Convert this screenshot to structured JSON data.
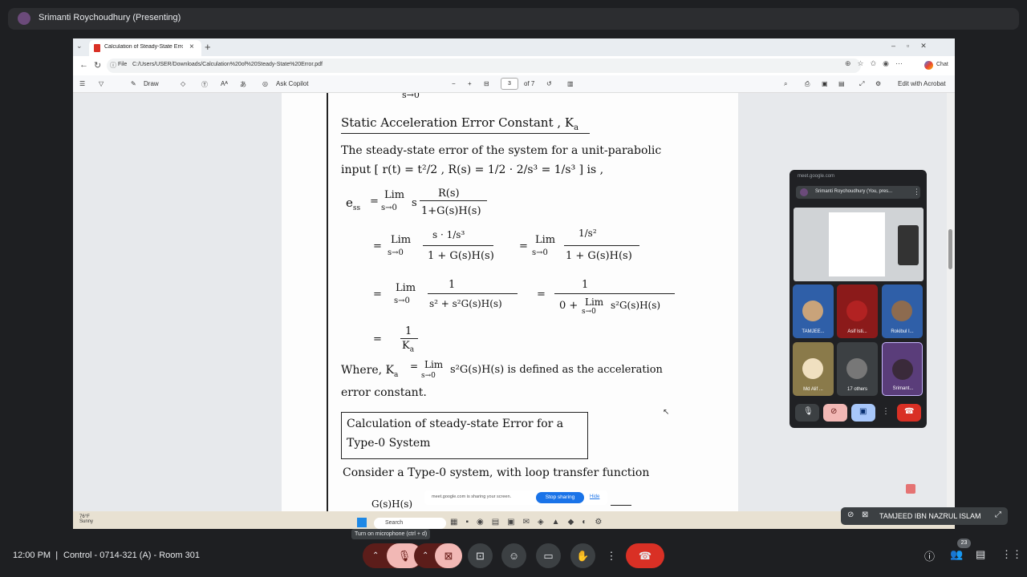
{
  "meet": {
    "presenting_label": "Srimanti Roychoudhury (Presenting)",
    "time": "12:00 PM",
    "separator": "|",
    "meeting_name": "Control - 0714-321 (A) - Room 301",
    "tooltip": "Turn on microphone (ctrl + d)",
    "participant_count": "23",
    "name_chip": "TAMJEED IBN NAZRUL ISLAM"
  },
  "browser": {
    "tab_title": "Calculation of Steady-State Error.p",
    "file_label": "File",
    "url": "C:/Users/USER/Downloads/Calculation%20of%20Steady-State%20Error.pdf",
    "chat_label": "Chat"
  },
  "pdf_toolbar": {
    "draw": "Draw",
    "ask_copilot": "Ask Copilot",
    "page_number": "3",
    "page_total": "of 7",
    "edit_acrobat": "Edit with Acrobat"
  },
  "pdf": {
    "top_fragment": "s→0",
    "heading": "Static Acceleration Error Constant , K",
    "heading_sub": "a",
    "line1": "The steady-state error of the system for a unit-parabolic",
    "line2": "input [ r(t) = t²/2 , R(s) = 1/2 · 2/s³ = 1/s³ ] is ,",
    "ess": "e",
    "ess_sub": "ss",
    "lim": "Lim",
    "lim_sub": "s→0",
    "s_rs": "s",
    "rs": "R(s)",
    "den1": "1+G(s)H(s)",
    "s_dot": "s · 1/s³",
    "one_over_s2": "1/s²",
    "den2": "1 + G(s)H(s)",
    "num_one": "1",
    "den3": "s² + s²G(s)H(s)",
    "den4_prefix": "0 +",
    "den4_suffix": "s²G(s)H(s)",
    "eq": "=",
    "one_over_ka": "K",
    "ka_sub": "a",
    "where_text": "Where, K",
    "where_rest": "s²G(s)H(s)  is defined as the acceleration",
    "where_line2": "error constant.",
    "box_line1": "Calculation of steady-state Error for a",
    "box_line2": "Type-0 System",
    "consider": "Consider a Type-0 system, with loop transfer function",
    "gs": "G(s)H(s)"
  },
  "pip": {
    "url": "meet.google.com",
    "who": "Srimanti Roychoudhury (You, pres...",
    "tiles": [
      {
        "name": "TAMJEE..."
      },
      {
        "name": "Asif Isti..."
      },
      {
        "name": "Rokibul I..."
      },
      {
        "name": "Md Alif ..."
      },
      {
        "name": "17 others"
      },
      {
        "name": "Srimant..."
      }
    ]
  },
  "taskbar": {
    "temp": "76°F",
    "weather": "Sunny",
    "search": "Search"
  },
  "share": {
    "text": "meet.google.com is sharing your screen.",
    "stop": "Stop sharing",
    "hide": "Hide"
  },
  "colors": {
    "end_call": "#d93025",
    "mic_off": "#f2b8b5",
    "accent": "#1a73e8"
  }
}
